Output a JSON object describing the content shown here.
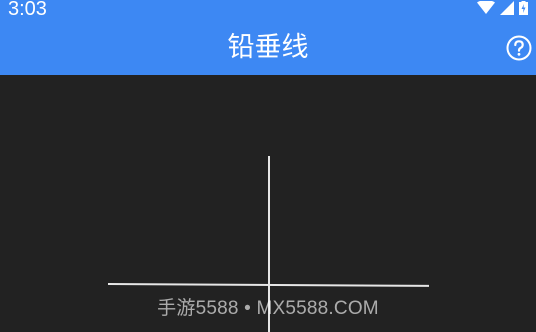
{
  "status_bar": {
    "time": "3:03",
    "icons": [
      "wifi-icon",
      "cellular-signal-icon",
      "battery-charging-icon"
    ]
  },
  "app_bar": {
    "title": "铅垂线",
    "help_icon": "help-circle-icon"
  },
  "colors": {
    "app_bar": "#3d88f3",
    "background": "#222222",
    "crosshair": "#e6e6e6"
  },
  "watermark": "手游5588 • MX5588.COM"
}
